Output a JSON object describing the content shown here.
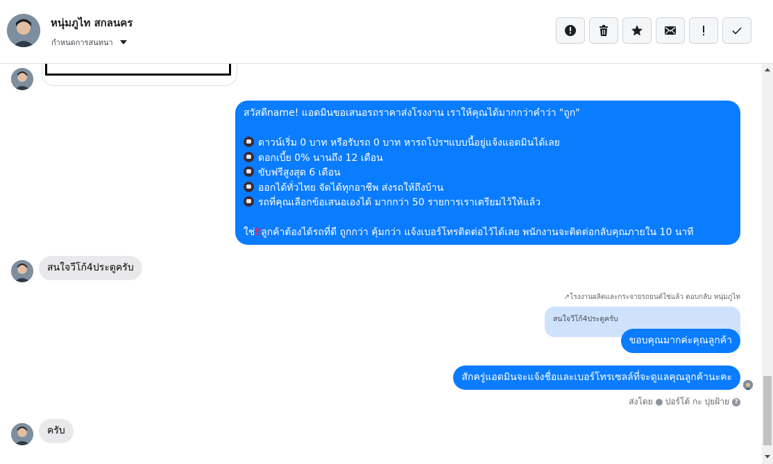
{
  "header": {
    "name": "หนุ่มภูไท สกลนคร",
    "assign_label": "กำหนดการสนทนา",
    "tools": [
      {
        "icon": "alert-circle-icon"
      },
      {
        "icon": "trash-icon"
      },
      {
        "icon": "star-icon"
      },
      {
        "icon": "mail-icon"
      },
      {
        "icon": "exclamation-icon"
      },
      {
        "icon": "check-icon"
      }
    ]
  },
  "messages": {
    "big_bubble": {
      "line1": "สวัสดีname! แอดมินขอเสนอรถราคาส่งโรงงาน เราให้คุณได้มากกว่าคำว่า \"ถูก\"",
      "bullets": [
        "ดาวน์เริ่ม 0 บาท หรือรับรถ 0 บาท หารถโปรฯแบบนี้อยู่แจ้งแอดมินได้เลย",
        "ดอกเบี้ย 0% นานถึง 12 เดือน",
        "ขับฟรีสูงสุด 6 เดือน",
        "ออกได้ทั่วไทย จัดได้ทุกอาชีพ ส่งรถให้ถึงบ้าน",
        "รถที่คุณเลือกข้อเสนอเองได้ มากกว่า 50 รายการเราเตรียมไว้ให้แล้ว"
      ],
      "closing_prefix": "ใช่",
      "closing_mark": "‼",
      "closing_text": "ลูกค้าต้องได้รถที่ดี ถูกกว่า คุ้มกว่า แจ้งเบอร์โทรติดต่อไว้ได้เลย พนักงานจะติดต่อกลับคุณภายใน 10 นาที"
    },
    "incoming_1": "สนใจวีโก้4ประตูครับ",
    "reply_meta": "โรงงานผลิตและกระจายรถยนต์ใช่แล้ว ตอบกลับ หนุ่มภูไท",
    "reply_quote": "สนใจวีโก้4ประตูครับ",
    "outgoing_1": "ขอบคุณมากค่ะคุณลูกค้า",
    "outgoing_2": "สักครู่แอดมินจะแจ้งชื่อและเบอร์โทรเซลล์ที่จะดูแลคุณลูกค้านะคะ",
    "read_by_label": "ส่งโดย",
    "read_by_name": "ปอร์โต้ กะ ปุยฝ้าย",
    "incoming_2": "ครับ"
  },
  "colors": {
    "outgoing_bubble": "#0a7cff",
    "incoming_bubble": "#e9e9eb",
    "quote_bubble": "#cfe2fb"
  }
}
